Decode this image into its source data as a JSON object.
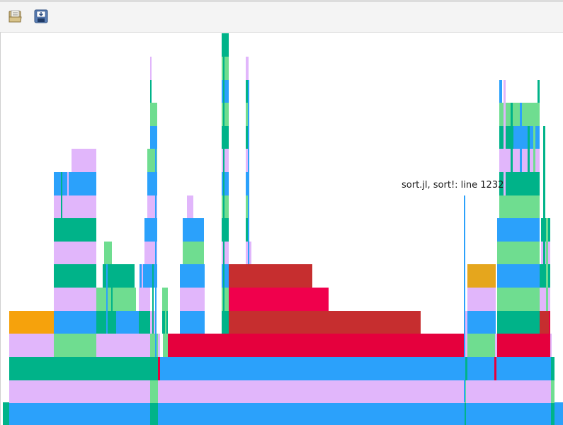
{
  "toolbar": {
    "open_icon": "folder-open-icon",
    "save_icon": "save-export-icon"
  },
  "tooltip": {
    "text": "sort.jl, sort!: line 1232"
  },
  "colors": {
    "blue": "#2ba1fb",
    "lavender": "#e1b6fb",
    "teal": "#00b389",
    "mint": "#6fdd90",
    "orange": "#f6a20c",
    "mustard": "#e5a61d",
    "crimson": "#e5003d",
    "red": "#c62e2f",
    "pinkred": "#f0004c"
  }
}
